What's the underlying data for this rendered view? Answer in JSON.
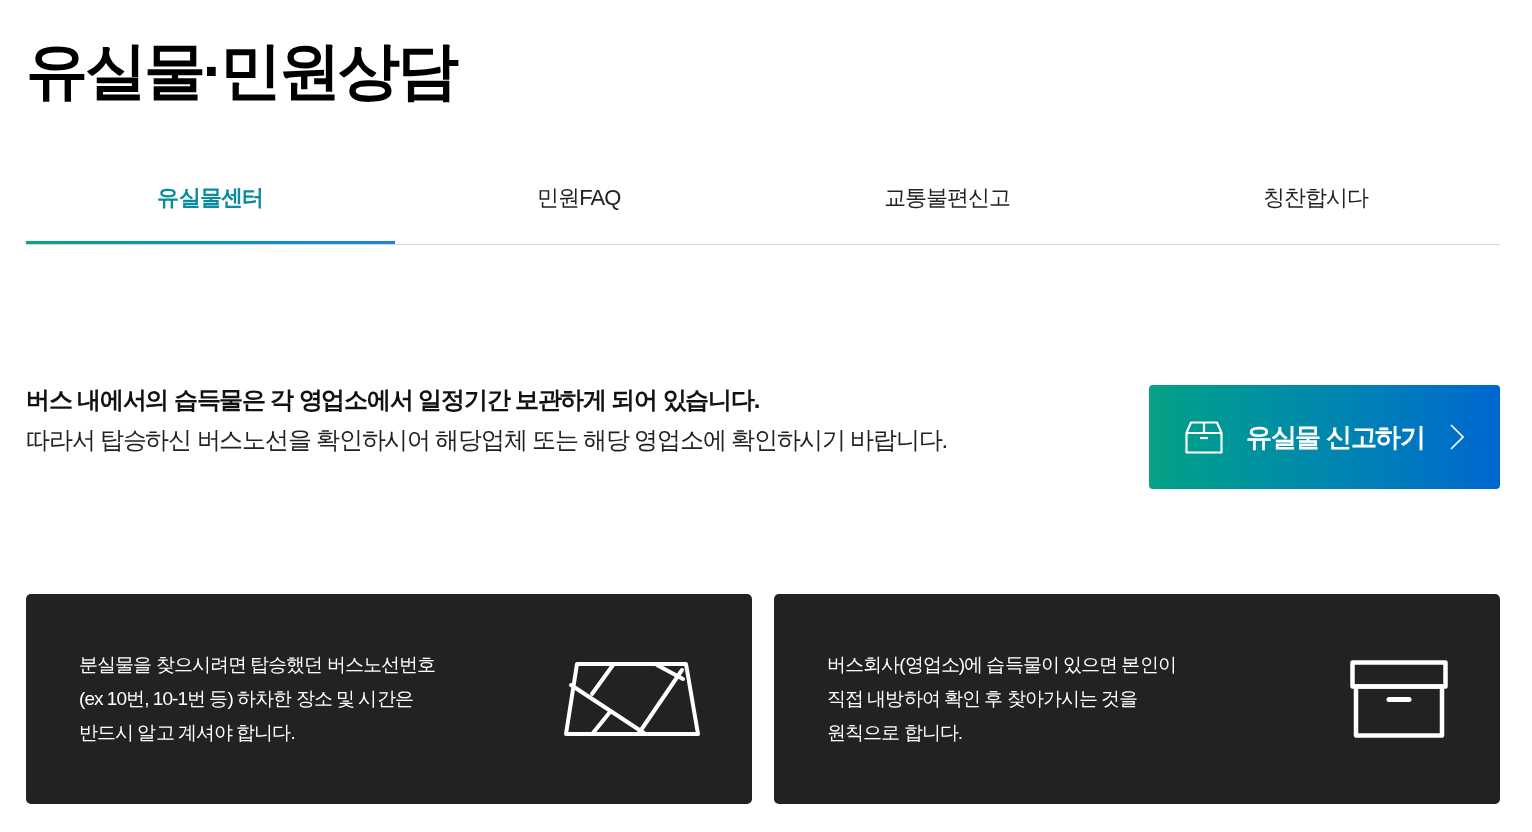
{
  "page_title": "유실물·민원상담",
  "tabs": [
    {
      "label": "유실물센터",
      "selected": true
    },
    {
      "label": "민원FAQ",
      "selected": false
    },
    {
      "label": "교통불편신고",
      "selected": false
    },
    {
      "label": "칭찬합시다",
      "selected": false
    }
  ],
  "notice": {
    "headline": "버스 내에서의 습득물은 각 영업소에서 일정기간 보관하게 되어 있습니다.",
    "body": "따라서 탑승하신 버스노선을 확인하시어 해당업체 또는 해당 영업소에 확인하시기 바랍니다."
  },
  "report_button": {
    "label": "유실물 신고하기"
  },
  "cards": [
    {
      "kind": "map",
      "lines": [
        "분실물을 찾으시려면 탑승했던 버스노선번호",
        "(ex 10번, 10-1번 등) 하차한 장소 및 시간은",
        "반드시 알고 계셔야 합니다."
      ]
    },
    {
      "kind": "box",
      "lines": [
        "버스회사(영업소)에 습득물이 있으면 본인이",
        "직접 내방하여 확인 후 찾아가시는 것을",
        "원칙으로 합니다."
      ]
    }
  ]
}
